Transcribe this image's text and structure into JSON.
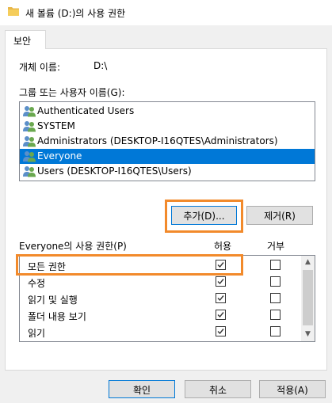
{
  "window": {
    "title": "새 볼륨 (D:)의 사용 권한"
  },
  "tabs": [
    {
      "label": "보안"
    }
  ],
  "object": {
    "label": "개체 이름:",
    "value": "D:\\"
  },
  "group_list": {
    "label": "그룹 또는 사용자 이름(G):",
    "items": [
      {
        "label": "Authenticated Users",
        "selected": false
      },
      {
        "label": "SYSTEM",
        "selected": false
      },
      {
        "label": "Administrators (DESKTOP-I16QTES\\Administrators)",
        "selected": false
      },
      {
        "label": "Everyone",
        "selected": true
      },
      {
        "label": "Users (DESKTOP-I16QTES\\Users)",
        "selected": false
      }
    ]
  },
  "buttons": {
    "add": "추가(D)...",
    "remove": "제거(R)",
    "ok": "확인",
    "cancel": "취소",
    "apply": "적용(A)"
  },
  "permissions": {
    "label": "Everyone의 사용 권한(P)",
    "col_allow": "허용",
    "col_deny": "거부",
    "rows": [
      {
        "name": "모든 권한",
        "allow": true,
        "deny": false
      },
      {
        "name": "수정",
        "allow": true,
        "deny": false
      },
      {
        "name": "읽기 및 실행",
        "allow": true,
        "deny": false
      },
      {
        "name": "폴더 내용 보기",
        "allow": true,
        "deny": false
      },
      {
        "name": "읽기",
        "allow": true,
        "deny": false
      }
    ]
  },
  "colors": {
    "highlight": "#f28a2b",
    "selection": "#0078d7"
  },
  "icons": {
    "title": "folder-icon",
    "user": "users-icon"
  }
}
